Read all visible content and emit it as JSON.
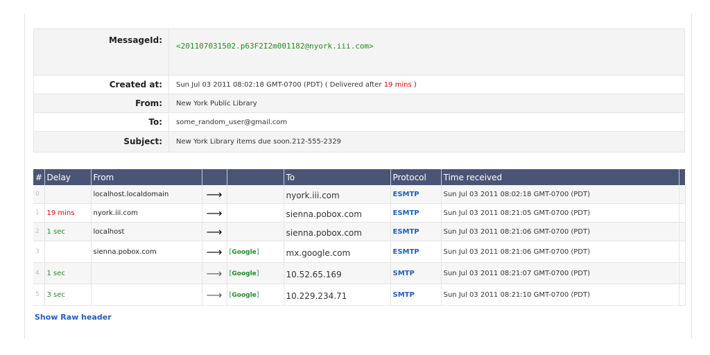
{
  "summary": {
    "message_id_label": "MessageId:",
    "message_id": "<201107031502.p63F2I2m001182@nyork.iii.com>",
    "created_label": "Created at:",
    "created_value": "Sun Jul 03 2011 08:02:18 GMT-0700 (PDT)",
    "delivered_prefix": "( Delivered after",
    "delivered_delay": "19 mins",
    "delivered_suffix": ")",
    "from_label": "From:",
    "from_value": "New York Public Library",
    "to_label": "To:",
    "to_value": "some_random_user@gmail.com",
    "subject_label": "Subject:",
    "subject_value": "New York Library items due soon.212-555-2329"
  },
  "hops": {
    "headers": {
      "num": "#",
      "delay": "Delay",
      "from": "From",
      "to": "To",
      "protocol": "Protocol",
      "time": "Time received"
    },
    "rows": [
      {
        "num": "0",
        "delay": "",
        "from": "localhost.localdomain",
        "arrow": "⟶",
        "badge": "",
        "to": "nyork.iii.com",
        "protocol": "ESMTP",
        "time": "Sun Jul 03 2011 08:02:18 GMT-0700 (PDT)"
      },
      {
        "num": "1",
        "delay": "19 mins",
        "from": "nyork.iii.com",
        "arrow": "⟶",
        "badge": "",
        "to": "sienna.pobox.com",
        "protocol": "ESMTP",
        "time": "Sun Jul 03 2011 08:21:05 GMT-0700 (PDT)"
      },
      {
        "num": "2",
        "delay": "1 sec",
        "from": "localhost",
        "arrow": "⟶",
        "badge": "",
        "to": "sienna.pobox.com",
        "protocol": "ESMTP",
        "time": "Sun Jul 03 2011 08:21:06 GMT-0700 (PDT)"
      },
      {
        "num": "3",
        "delay": "",
        "from": "sienna.pobox.com",
        "arrow": "⟶",
        "badge": "Google",
        "to": "mx.google.com",
        "protocol": "ESMTP",
        "time": "Sun Jul 03 2011 08:21:06 GMT-0700 (PDT)"
      },
      {
        "num": "4",
        "delay": "1 sec",
        "from": "",
        "arrow": "⟶",
        "badge": "Google",
        "to": "10.52.65.169",
        "protocol": "SMTP",
        "time": "Sun Jul 03 2011 08:21:07 GMT-0700 (PDT)"
      },
      {
        "num": "5",
        "delay": "3 sec",
        "from": "",
        "arrow": "⟶",
        "badge": "Google",
        "to": "10.229.234.71",
        "protocol": "SMTP",
        "time": "Sun Jul 03 2011 08:21:10 GMT-0700 (PDT)"
      }
    ]
  },
  "raw_header_link": "Show Raw header",
  "colors": {
    "header_bg": "#4a5576",
    "link_blue": "#1f5fbf",
    "delay_red": "#e00000",
    "delay_green": "#228b22",
    "google_green": "#228b22"
  }
}
